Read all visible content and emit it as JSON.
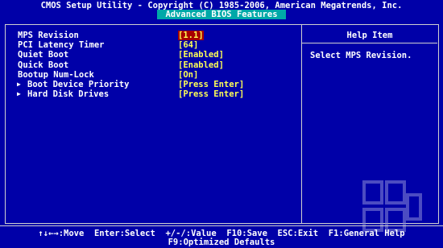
{
  "header": {
    "title": "CMOS Setup Utility - Copyright (C) 1985-2006, American Megatrends, Inc.",
    "subtitle": "Advanced BIOS Features"
  },
  "settings": [
    {
      "label": "MPS Revision",
      "value": "[1.1]",
      "selected": true,
      "submenu": false
    },
    {
      "label": "PCI Latency Timer",
      "value": "[64]",
      "selected": false,
      "submenu": false
    },
    {
      "label": "Quiet Boot",
      "value": "[Enabled]",
      "selected": false,
      "submenu": false
    },
    {
      "label": "Quick Boot",
      "value": "[Enabled]",
      "selected": false,
      "submenu": false
    },
    {
      "label": "Bootup Num-Lock",
      "value": "[On]",
      "selected": false,
      "submenu": false
    },
    {
      "label": "Boot Device Priority",
      "value": "[Press Enter]",
      "selected": false,
      "submenu": true
    },
    {
      "label": "Hard Disk Drives",
      "value": "[Press Enter]",
      "selected": false,
      "submenu": true
    }
  ],
  "help": {
    "title": "Help Item",
    "text": "Select MPS Revision."
  },
  "footer": {
    "line1": "↑↓←→:Move  Enter:Select  +/-/:Value  F10:Save  ESC:Exit  F1:General Help",
    "line2": "F9:Optimized Defaults"
  },
  "colors": {
    "background": "#0000a8",
    "highlight": "#a80000",
    "value_text": "#ffff55",
    "subtitle_bg": "#00a8a8"
  }
}
